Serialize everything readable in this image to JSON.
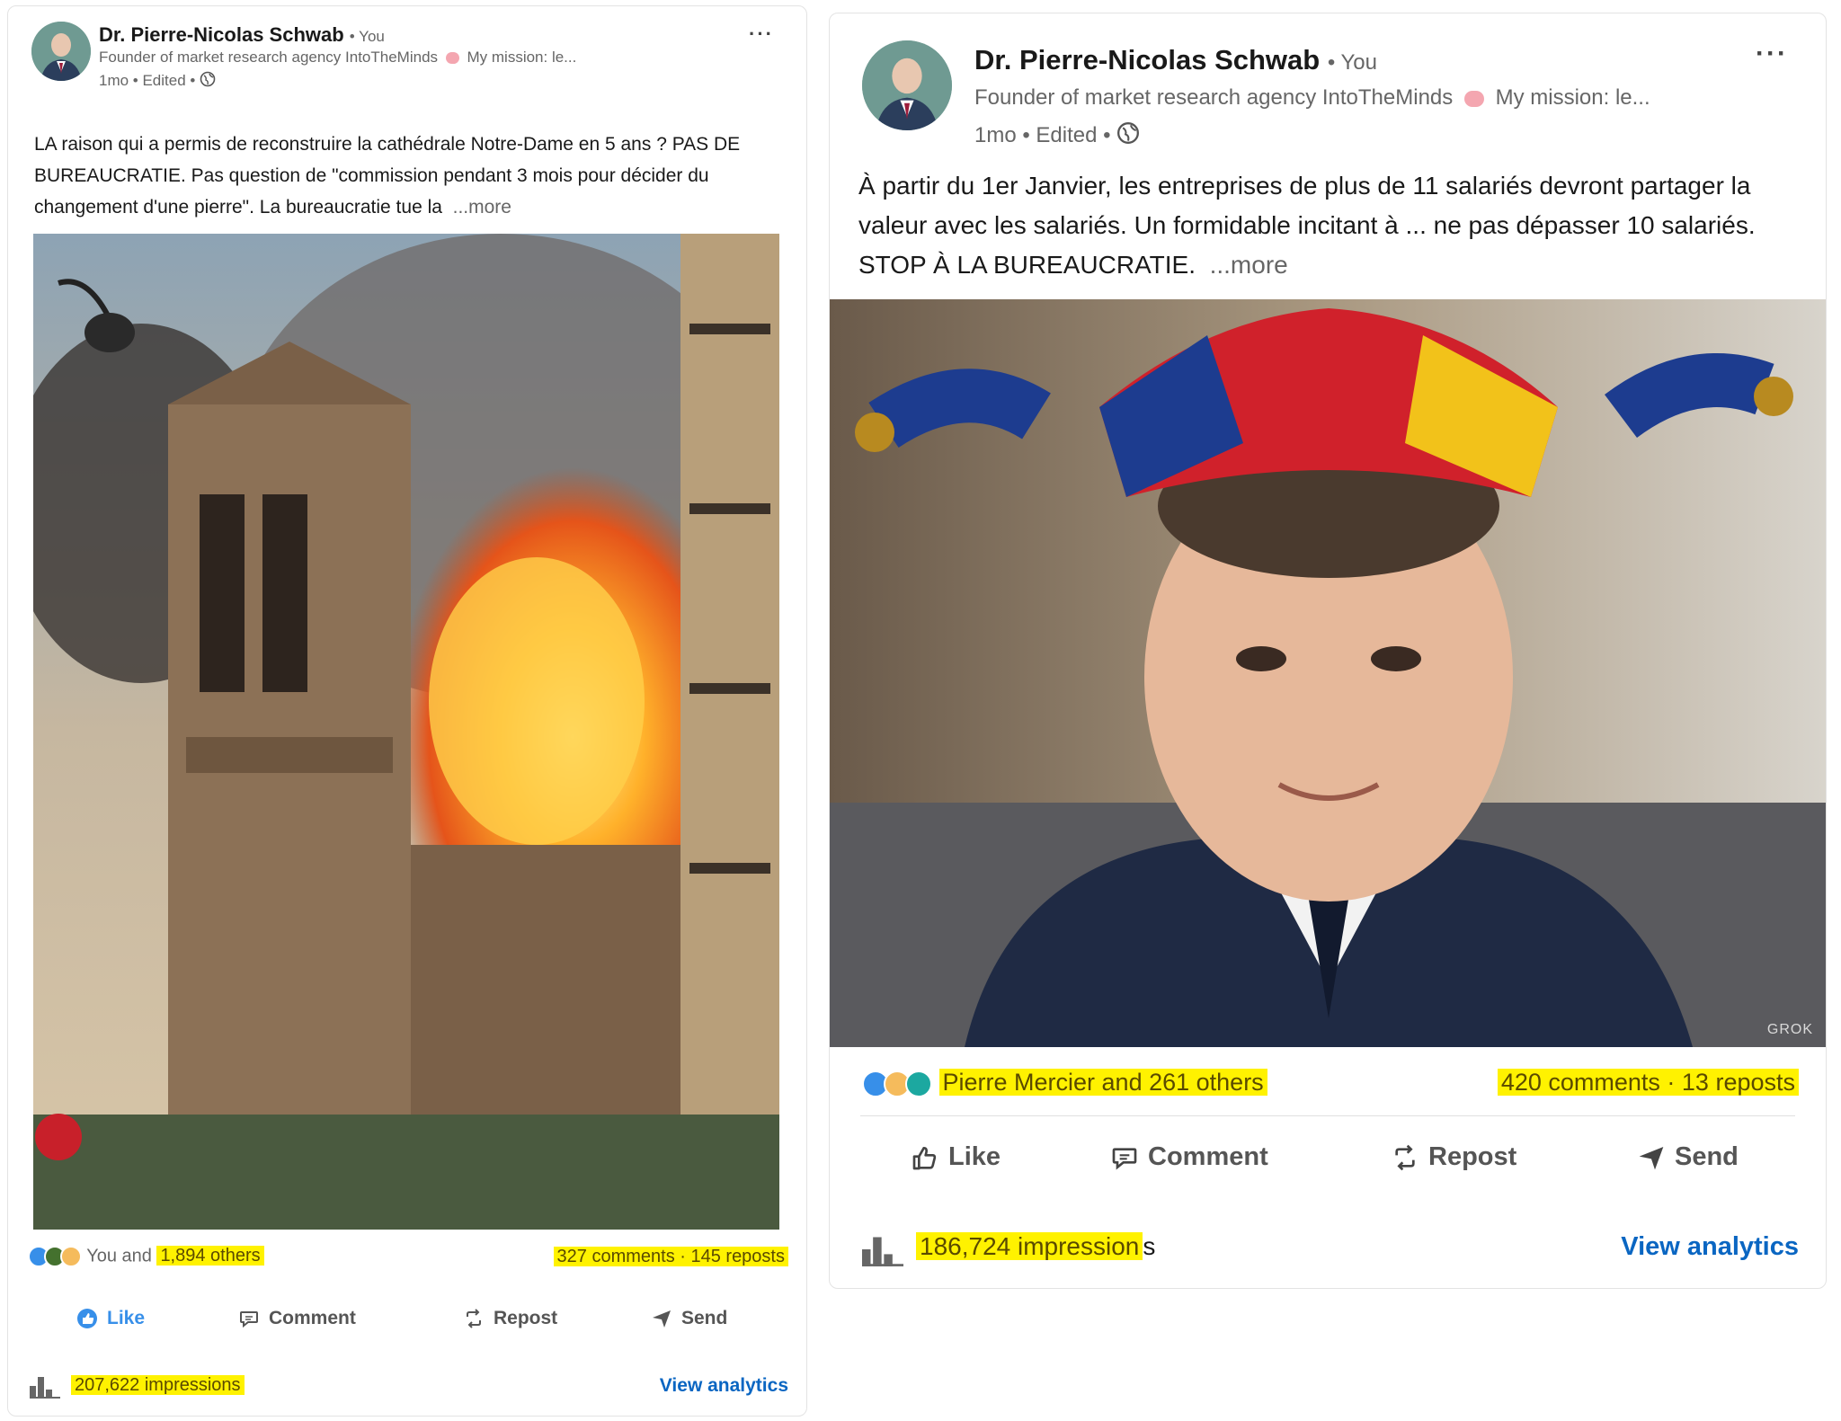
{
  "posts": [
    {
      "author": "Dr. Pierre-Nicolas Schwab",
      "you_tag": "• You",
      "headline": "Founder of market research agency IntoTheMinds",
      "headline_tail": "My mission: le...",
      "meta": "1mo • Edited •",
      "text": "LA raison qui a permis de reconstruire la cathédrale Notre-Dame en 5 ans ? PAS DE BUREAUCRATIE. Pas question de \"commission pendant 3 mois pour décider du changement d'une pierre\". La bureaucratie tue la",
      "more": "...more",
      "image_icon": "notre-dame-fire-photo",
      "reactions_prefix": "You and ",
      "reactions_highlight": "1,894 others",
      "comments_reposts": "327 comments · 145 reposts",
      "actions": [
        "Like",
        "Comment",
        "Repost",
        "Send"
      ],
      "impressions": "207,622 impressions",
      "view_analytics": "View analytics",
      "like_active": true
    },
    {
      "author": "Dr. Pierre-Nicolas Schwab",
      "you_tag": "• You",
      "headline": "Founder of market research agency IntoTheMinds",
      "headline_tail": "My mission: le...",
      "meta": "1mo • Edited •",
      "text": "À partir du 1er Janvier, les entreprises de plus de 11 salariés devront partager la valeur avec les salariés. Un formidable incitant à ... ne pas dépasser 10 salariés. STOP À LA BUREAUCRATIE.",
      "more": "...more",
      "image_icon": "jester-hat-portrait",
      "image_watermark": "GROK",
      "reactions_highlight": "Pierre Mercier and 261 others",
      "comments_reposts": "420 comments · 13 reposts",
      "actions": [
        "Like",
        "Comment",
        "Repost",
        "Send"
      ],
      "impressions_highlight": "186,724 impression",
      "impressions_tail": "s",
      "view_analytics": "View analytics",
      "like_active": false
    }
  ],
  "colors": {
    "highlight": "#fff200",
    "link": "#0a66c2",
    "like_active": "#378fe9"
  }
}
